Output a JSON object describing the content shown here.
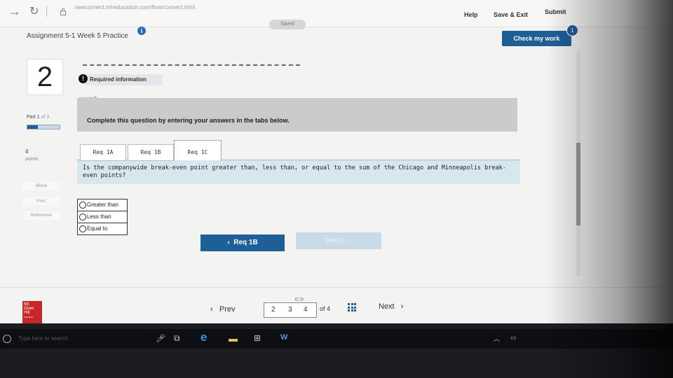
{
  "browser": {
    "url": "newconnect.mheducation.com/flow/connect.html"
  },
  "header": {
    "saved_label": "Saved",
    "help_label": "Help",
    "save_exit_label": "Save & Exit",
    "submit_label": "Submit",
    "assignment_title": "Assignment 5-1 Week 5 Practice",
    "info_icon_glyph": "i",
    "check_work_label": "Check my work",
    "check_work_badge": "1"
  },
  "question": {
    "number": "2",
    "required_info_label": "Required information",
    "alert_icon_glyph": "!",
    "points_question": "points?",
    "part_label": "Part 1",
    "part_of": "of 3",
    "part_progress": 0.33,
    "points_value": "4",
    "points_label": "points"
  },
  "sidebar": {
    "ebook": "eBook",
    "print": "Print",
    "references": "References"
  },
  "content": {
    "complete_instruction": "Complete this question by entering your answers in the tabs below.",
    "tabs": [
      {
        "label": "Req 1A"
      },
      {
        "label": "Req 1B"
      },
      {
        "label": "Req 1C"
      }
    ],
    "active_tab": "Req 1C",
    "question_text": "Is the companywide break-even point greater than, less than, or equal to the sum of the Chicago and Minneapolis break-even points?",
    "options": [
      {
        "label": "Greater than"
      },
      {
        "label": "Less than"
      },
      {
        "label": "Equal to"
      }
    ],
    "prev_req_label": "Req 1B",
    "next_req_label": "Req 1C"
  },
  "footer": {
    "prev_label": "Prev",
    "pages": [
      "2",
      "3",
      "4"
    ],
    "of_pages": "of 4",
    "next_label": "Next",
    "logo_lines": [
      "Mc",
      "Graw",
      "Hill",
      "Education"
    ]
  },
  "taskbar": {
    "search_placeholder": "Type here to search"
  },
  "colors": {
    "accent": "#1f5f98",
    "logo_red": "#c8262a"
  }
}
